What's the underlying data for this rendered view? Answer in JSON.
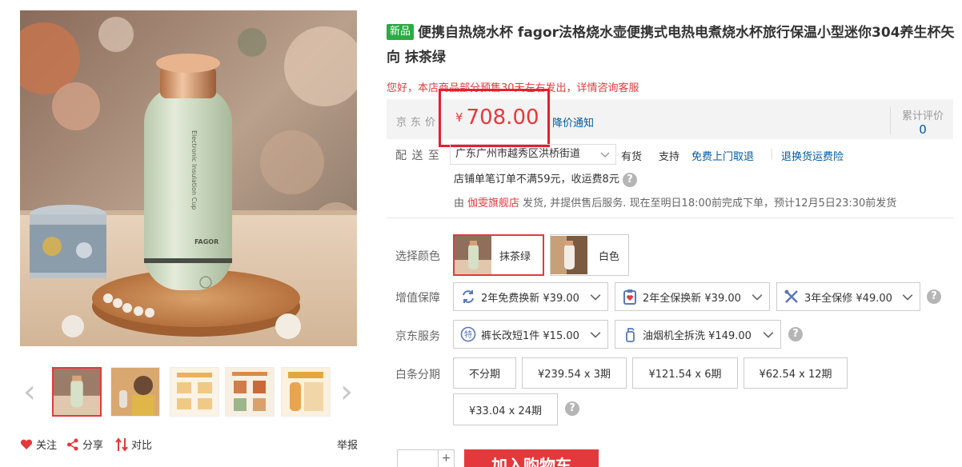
{
  "product": {
    "badge": "新品",
    "title": "便携自热烧水杯 fagor法格烧水壶便携式电热电煮烧水杯旅行保温小型迷你304养生杯矢向 抹茶绿",
    "notice": "您好，本店商品部分预售30天左右发出，详情咨询客服"
  },
  "price": {
    "label": "京东价",
    "currency": "¥",
    "value": "708.00",
    "notify": "降价通知",
    "review_label": "累计评价",
    "review_count": "0"
  },
  "delivery": {
    "label": "配 送 至",
    "address": "广东广州市越秀区洪桥街道",
    "stock": "有货",
    "support_label": "支持",
    "pickup": "免费上门取退",
    "return_insurance": "退换货运费险",
    "fee_note": "店铺单笔订单不满59元，收运费8元",
    "seller_prefix": "由",
    "shop_name": "伽雯旗舰店",
    "seller_suffix": "发货, 并提供售后服务. 现在至明日18:00前完成下单，预计12月5日23:30前发货"
  },
  "color": {
    "label": "选择颜色",
    "options": [
      {
        "name": "抹茶绿",
        "selected": true
      },
      {
        "name": "白色",
        "selected": false
      }
    ]
  },
  "warranty": {
    "label": "增值保障",
    "options": [
      "2年免费换新 ¥39.00",
      "2年全保换新 ¥39.00",
      "3年全保修 ¥49.00"
    ]
  },
  "jd_service": {
    "label": "京东服务",
    "options": [
      "裤长改短1件 ¥15.00",
      "油烟机全拆洗 ¥149.00"
    ]
  },
  "installment": {
    "label": "白条分期",
    "options": [
      "不分期",
      "¥239.54 x 3期",
      "¥121.54 x 6期",
      "¥62.54 x 12期",
      "¥33.04 x 24期"
    ]
  },
  "actions": {
    "follow": "关注",
    "share": "分享",
    "compare": "对比",
    "report": "举报"
  },
  "purchase": {
    "qty_plus": "+",
    "buy_label": "加入购物车"
  },
  "thumb_label": "Electronic Insulation Cup",
  "brand_mark": "FAGOR",
  "colors": {
    "accent": "#e4393c",
    "link": "#005aa0",
    "badge_green": "#2bac43",
    "price_bg": "#f3f3f3"
  }
}
